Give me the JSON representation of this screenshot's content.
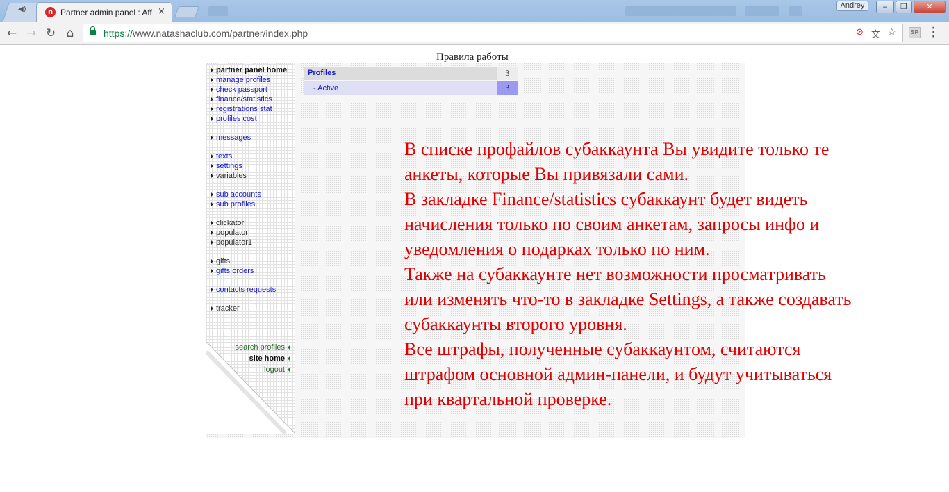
{
  "browser": {
    "tab_title": "Partner admin panel : Aff",
    "tab_close": "×",
    "profile_name": "Andrey",
    "url_scheme": "https://",
    "url_rest": "www.natashaclub.com/partner/index.php",
    "extension_label": "SP",
    "icons": [
      "back-arrow-icon",
      "forward-arrow-icon",
      "reload-icon",
      "home-icon",
      "lock-icon",
      "translate-icon",
      "star-icon",
      "menu-icon"
    ]
  },
  "page": {
    "rules_title": "Правила работы",
    "sidebar": {
      "items": [
        {
          "label": "partner panel home",
          "style": "current"
        },
        {
          "label": "manage profiles",
          "style": "link"
        },
        {
          "label": "check passport",
          "style": "link"
        },
        {
          "label": "finance/statistics",
          "style": "link"
        },
        {
          "label": "registrations stat",
          "style": "link"
        },
        {
          "label": "profiles cost",
          "style": "link"
        },
        {
          "label": "messages",
          "style": "link"
        },
        {
          "label": "texts",
          "style": "link"
        },
        {
          "label": "settings",
          "style": "link"
        },
        {
          "label": "variables",
          "style": "plain"
        },
        {
          "label": "sub accounts",
          "style": "link"
        },
        {
          "label": "sub profiles",
          "style": "link"
        },
        {
          "label": "clickator",
          "style": "plain"
        },
        {
          "label": "populator",
          "style": "plain"
        },
        {
          "label": "populator1",
          "style": "plain"
        },
        {
          "label": "gifts",
          "style": "plain"
        },
        {
          "label": "gifts orders",
          "style": "link"
        },
        {
          "label": "contacts requests",
          "style": "link"
        },
        {
          "label": "tracker",
          "style": "plain"
        }
      ],
      "bottom": {
        "search_profiles": "search profiles",
        "site_home": "site home",
        "logout": "logout"
      }
    },
    "stats": {
      "profiles_label": "Profiles",
      "profiles_count": "3",
      "active_label": "- Active",
      "active_count": "3"
    },
    "note_lines": [
      "В списке профайлов субаккаунта Вы увидите только те",
      "анкеты, которые Вы привязали сами.",
      "В закладке Finance/statistics субаккаунт будет видеть",
      "начисления только по своим анкетам, запросы инфо и",
      "уведомления о подарках только по ним.",
      "Также на субаккаунте нет возможности просматривать",
      "или изменять что-то в закладке Settings, а также создавать",
      "субаккаунты второго уровня.",
      "Все штрафы, полученные субаккаунтом, считаются",
      "штрафом основной админ-панели, и будут учитываться",
      "при квартальной проверке."
    ],
    "colors": {
      "note_text": "#e00000",
      "link": "#1a1acc",
      "active_count_bg": "#9a9af2"
    }
  }
}
